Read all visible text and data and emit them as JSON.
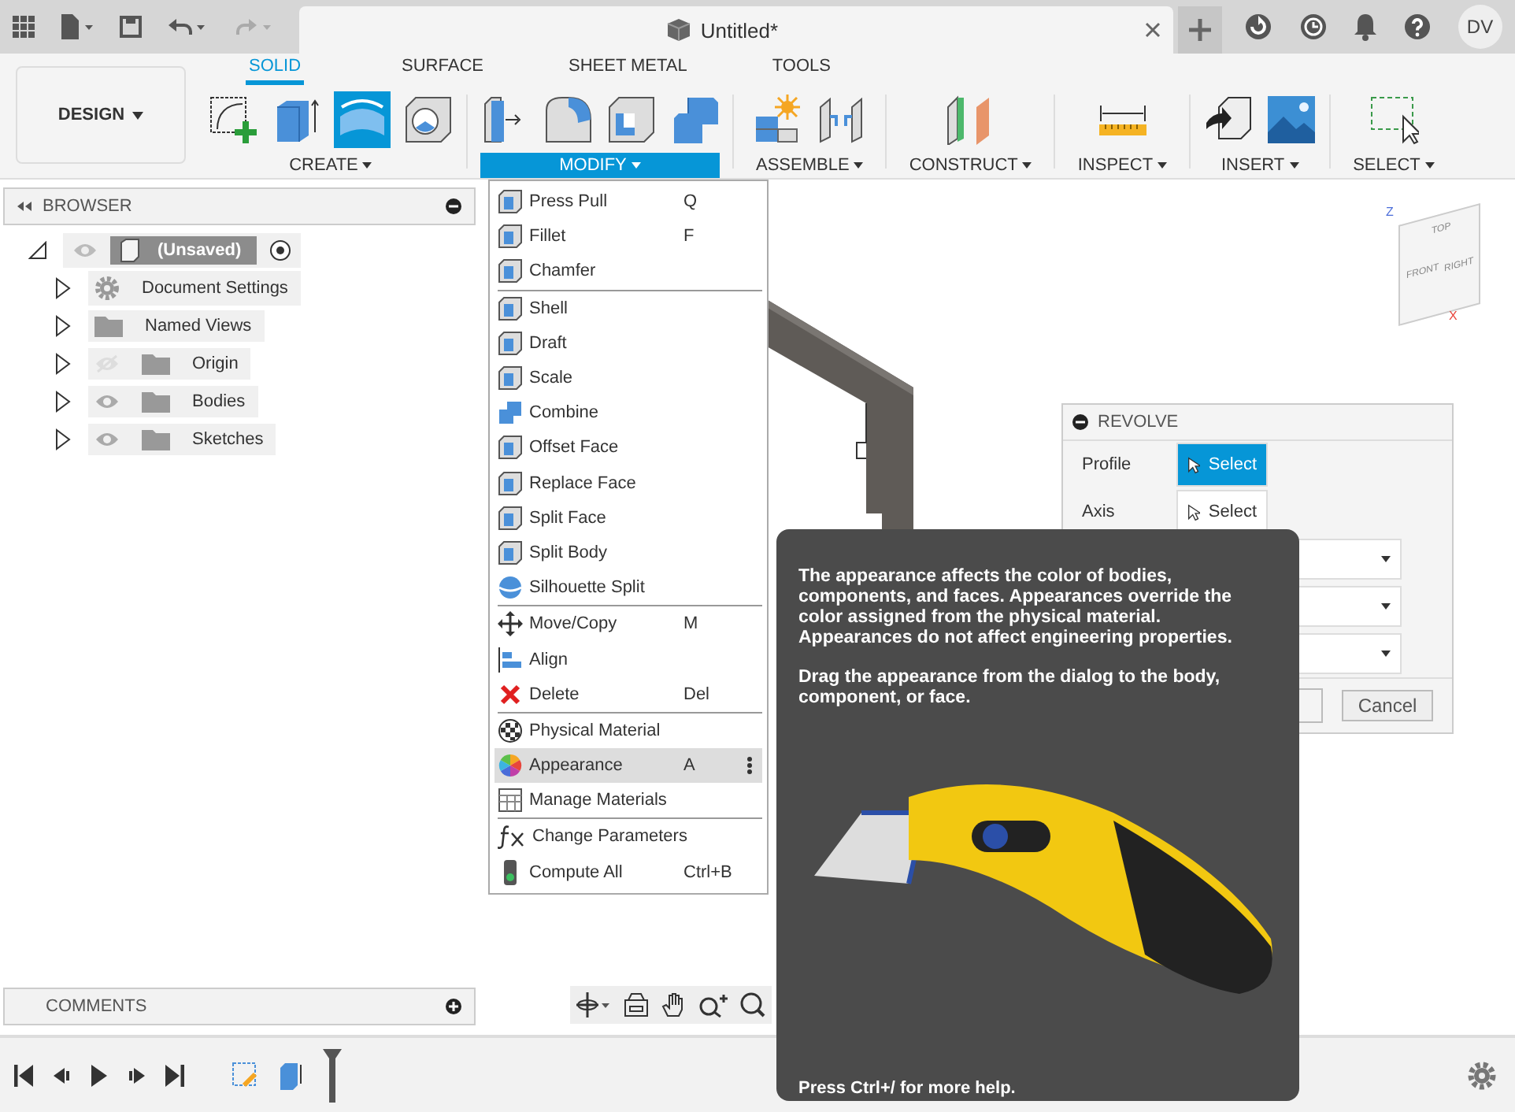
{
  "title_bar": {
    "document_title": "Untitled*",
    "user_initials": "DV"
  },
  "workspace_switcher": {
    "label": "DESIGN"
  },
  "toolbar_tabs": [
    {
      "label": "SOLID",
      "selected": true
    },
    {
      "label": "SURFACE",
      "selected": false
    },
    {
      "label": "SHEET METAL",
      "selected": false
    },
    {
      "label": "TOOLS",
      "selected": false
    }
  ],
  "toolbar_groups": [
    {
      "label": "CREATE",
      "expanded": false
    },
    {
      "label": "MODIFY",
      "expanded": true
    },
    {
      "label": "ASSEMBLE",
      "expanded": false
    },
    {
      "label": "CONSTRUCT",
      "expanded": false
    },
    {
      "label": "INSPECT",
      "expanded": false
    },
    {
      "label": "INSERT",
      "expanded": false
    },
    {
      "label": "SELECT",
      "expanded": false
    }
  ],
  "browser": {
    "title": "BROWSER",
    "root": {
      "label": "(Unsaved)",
      "expanded": true
    },
    "items": [
      {
        "label": "Document Settings",
        "kind": "settings",
        "expanded": false
      },
      {
        "label": "Named Views",
        "kind": "folder",
        "expanded": false
      },
      {
        "label": "Origin",
        "kind": "folder",
        "expanded": false,
        "visible": false
      },
      {
        "label": "Bodies",
        "kind": "folder",
        "expanded": false,
        "visible": true
      },
      {
        "label": "Sketches",
        "kind": "folder",
        "expanded": false,
        "visible": true
      }
    ]
  },
  "modify_menu": {
    "groups": [
      {
        "items": [
          {
            "label": "Press Pull",
            "shortcut": "Q",
            "selected": false
          },
          {
            "label": "Fillet",
            "shortcut": "F",
            "selected": false
          },
          {
            "label": "Chamfer",
            "selected": false
          }
        ]
      },
      {
        "items": [
          {
            "label": "Shell",
            "selected": false
          },
          {
            "label": "Draft",
            "selected": false
          },
          {
            "label": "Scale",
            "selected": false
          },
          {
            "label": "Combine",
            "selected": false
          },
          {
            "label": "Offset Face",
            "selected": false
          },
          {
            "label": "Replace Face",
            "selected": false
          },
          {
            "label": "Split Face",
            "selected": false
          },
          {
            "label": "Split Body",
            "selected": false
          },
          {
            "label": "Silhouette Split",
            "selected": false
          }
        ]
      },
      {
        "items": [
          {
            "label": "Move/Copy",
            "shortcut": "M",
            "selected": false
          },
          {
            "label": "Align",
            "selected": false
          },
          {
            "label": "Delete",
            "shortcut": "Del",
            "selected": false
          }
        ]
      },
      {
        "items": [
          {
            "label": "Physical Material",
            "selected": false
          },
          {
            "label": "Appearance",
            "shortcut": "A",
            "selected": true
          },
          {
            "label": "Manage Materials",
            "selected": false
          }
        ]
      },
      {
        "items": [
          {
            "label": "Change Parameters",
            "selected": false
          },
          {
            "label": "Compute All",
            "shortcut": "Ctrl+B",
            "selected": false
          }
        ]
      }
    ]
  },
  "revolve_dialog": {
    "title": "REVOLVE",
    "fields": [
      {
        "label": "Profile",
        "value": "Select",
        "selected": true
      },
      {
        "label": "Axis",
        "value": "Select",
        "selected": false
      }
    ],
    "cancel_label": "Cancel"
  },
  "tooltip": {
    "paragraphs": [
      "The appearance affects the color of bodies, components, and faces. Appearances override the color assigned from the physical material. Appearances do not affect engineering properties.",
      "Drag the appearance from the dialog to the body, component, or face."
    ],
    "footer": "Press Ctrl+/ for more help."
  },
  "viewcube": {
    "faces": [
      "TOP",
      "FRONT",
      "RIGHT"
    ],
    "axes": [
      "Z",
      "X"
    ]
  },
  "comments_panel": {
    "title": "COMMENTS"
  }
}
